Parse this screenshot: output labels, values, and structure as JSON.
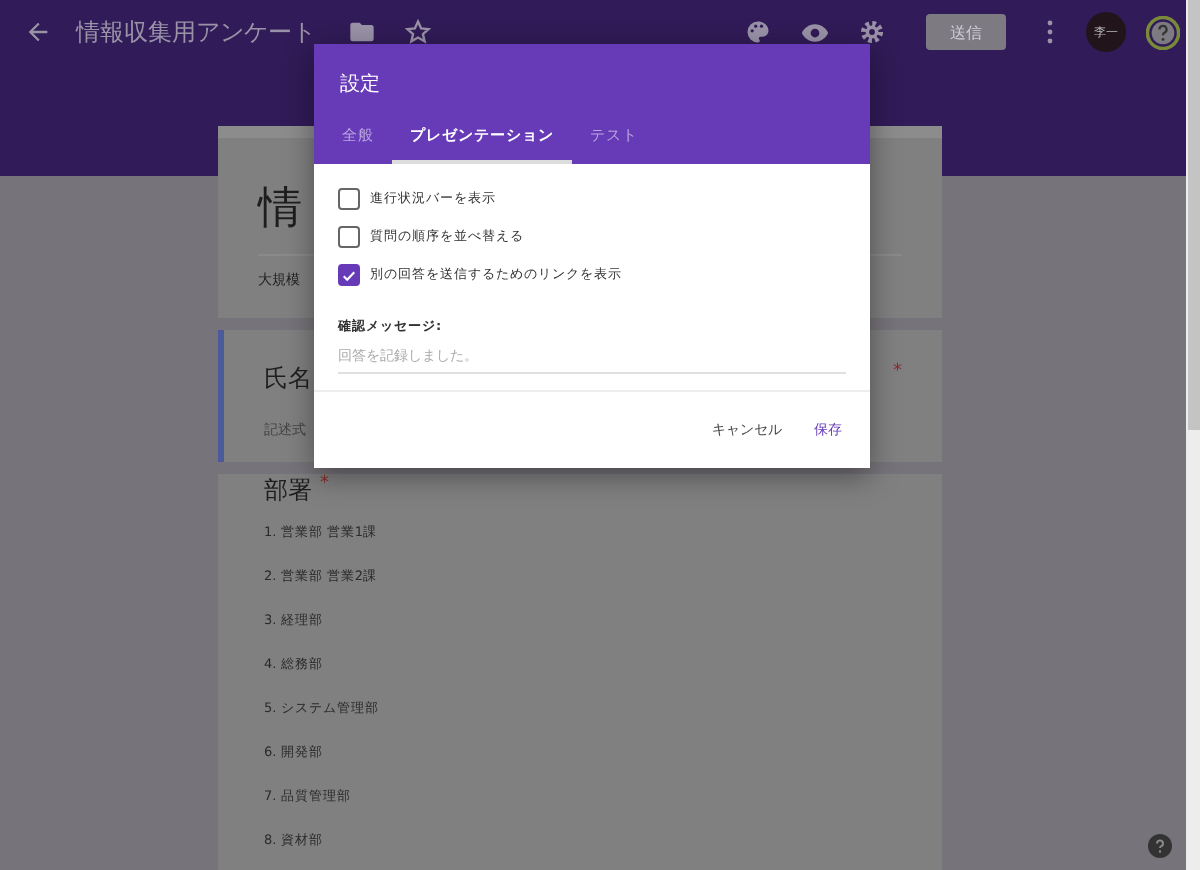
{
  "toolbar": {
    "title": "情報収集用アンケート",
    "send_button": "送信",
    "avatar": "李一"
  },
  "form": {
    "title": "情",
    "description": "大規模",
    "questions": [
      {
        "title": "氏名",
        "required_mark": "*",
        "placeholder": "記述式",
        "focused": true
      },
      {
        "title": "部署",
        "required_mark": "*",
        "focused": false,
        "options": [
          "1. 営業部 営業1課",
          "2. 営業部 営業2課",
          "3. 経理部",
          "4. 総務部",
          "5. システム管理部",
          "6. 開発部",
          "7. 品質管理部",
          "8. 資材部"
        ]
      }
    ]
  },
  "dialog": {
    "title": "設定",
    "tabs": [
      {
        "label": "全般",
        "selected": false
      },
      {
        "label": "プレゼンテーション",
        "selected": true
      },
      {
        "label": "テスト",
        "selected": false
      }
    ],
    "options": [
      {
        "label": "進行状況バーを表示",
        "checked": false
      },
      {
        "label": "質問の順序を並べ替える",
        "checked": false
      },
      {
        "label": "別の回答を送信するためのリンクを表示",
        "checked": true
      }
    ],
    "confirmation_label": "確認メッセージ:",
    "confirmation_placeholder": "回答を記録しました。",
    "buttons": [
      {
        "label": "キャンセル",
        "kind": "secondary"
      },
      {
        "label": "保存",
        "kind": "primary"
      }
    ]
  }
}
